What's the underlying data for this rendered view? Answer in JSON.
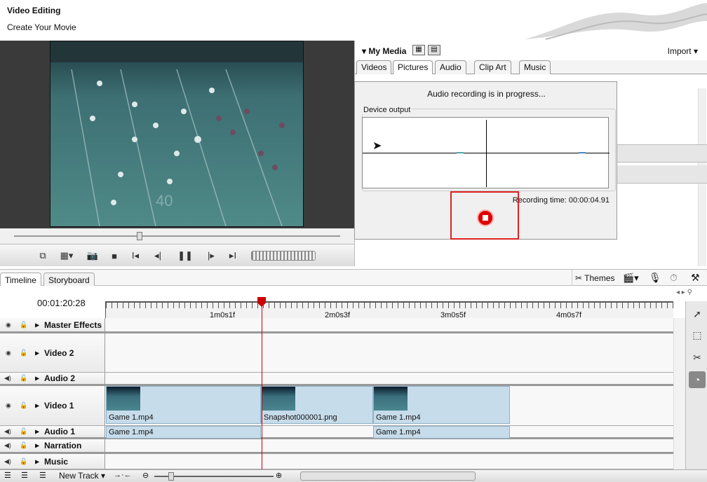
{
  "header": {
    "title": "Video Editing",
    "subtitle": "Create Your Movie"
  },
  "media": {
    "title": "My Media",
    "import_label": "Import",
    "tabs": [
      {
        "label": "Videos"
      },
      {
        "label": "Pictures"
      },
      {
        "label": "Audio"
      },
      {
        "label": "Clip Art"
      },
      {
        "label": "Music"
      }
    ],
    "active_tab": "Pictures"
  },
  "dialog": {
    "message": "Audio recording is in progress...",
    "device_label": "Device output",
    "recording_time": "Recording time: 00:00:04.91"
  },
  "timeline": {
    "tabs": [
      {
        "label": "Timeline"
      },
      {
        "label": "Storyboard"
      }
    ],
    "themes_label": "Themes",
    "timecode": "00:01:20:28",
    "ruler_ticks": [
      "1m0s1f",
      "2m0s3f",
      "3m0s5f",
      "4m0s7f"
    ],
    "tracks": [
      {
        "name": "Master Effects"
      },
      {
        "name": "Video 2"
      },
      {
        "name": "Audio 2"
      },
      {
        "name": "Video 1"
      },
      {
        "name": "Audio 1"
      },
      {
        "name": "Narration"
      },
      {
        "name": "Music"
      }
    ],
    "video1_clips": [
      {
        "label": "Game 1.mp4"
      },
      {
        "label": "Snapshot000001.png"
      },
      {
        "label": "Game 1.mp4"
      }
    ],
    "audio1_clips": [
      {
        "label": "Game 1.mp4"
      },
      {
        "label": "Game 1.mp4"
      }
    ],
    "new_track_label": "New Track"
  },
  "icons": [
    "swoosh-graphic",
    "snapshot-icon",
    "stop-icon",
    "split-icon",
    "prev-frame-icon",
    "pause-icon",
    "next-frame-icon",
    "record-stop-icon",
    "microphone-icon",
    "pointer-icon",
    "scissors-icon",
    "wrench-icon"
  ]
}
